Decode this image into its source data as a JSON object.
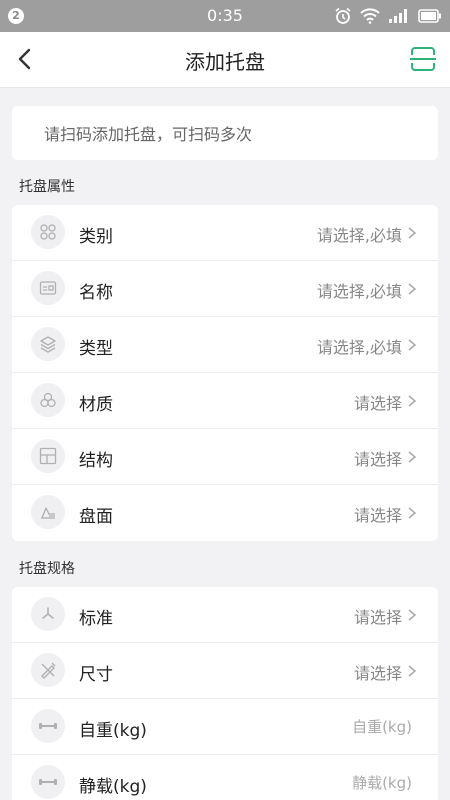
{
  "status_bar": {
    "badge": "2",
    "time": "0:35",
    "icons": [
      "alarm-icon",
      "wifi-icon",
      "signal-icon",
      "battery-icon"
    ]
  },
  "header": {
    "title": "添加托盘",
    "back_icon": "chevron-left-icon",
    "scan_icon": "scan-icon",
    "accent_color": "#2db37a"
  },
  "scan": {
    "hint": "请扫码添加托盘，可扫码多次"
  },
  "sections": [
    {
      "title": "托盘属性",
      "rows": [
        {
          "icon": "category-grid-icon",
          "label": "类别",
          "value": "请选择,必填",
          "chevron": true
        },
        {
          "icon": "id-card-icon",
          "label": "名称",
          "value": "请选择,必填",
          "chevron": true
        },
        {
          "icon": "layers-icon",
          "label": "类型",
          "value": "请选择,必填",
          "chevron": true
        },
        {
          "icon": "circles-icon",
          "label": "材质",
          "value": "请选择",
          "chevron": true
        },
        {
          "icon": "layout-icon",
          "label": "结构",
          "value": "请选择",
          "chevron": true
        },
        {
          "icon": "surface-icon",
          "label": "盘面",
          "value": "请选择",
          "chevron": true
        }
      ]
    },
    {
      "title": "托盘规格",
      "rows": [
        {
          "icon": "standard-icon",
          "label": "标准",
          "value": "请选择",
          "chevron": true
        },
        {
          "icon": "ruler-pencil-icon",
          "label": "尺寸",
          "value": "请选择",
          "chevron": true
        },
        {
          "icon": "dumbbell-icon",
          "label": "自重(kg)",
          "placeholder": "自重(kg)",
          "chevron": false
        },
        {
          "icon": "dumbbell-icon",
          "label": "静载(kg)",
          "placeholder": "静载(kg)",
          "chevron": false
        }
      ]
    }
  ]
}
